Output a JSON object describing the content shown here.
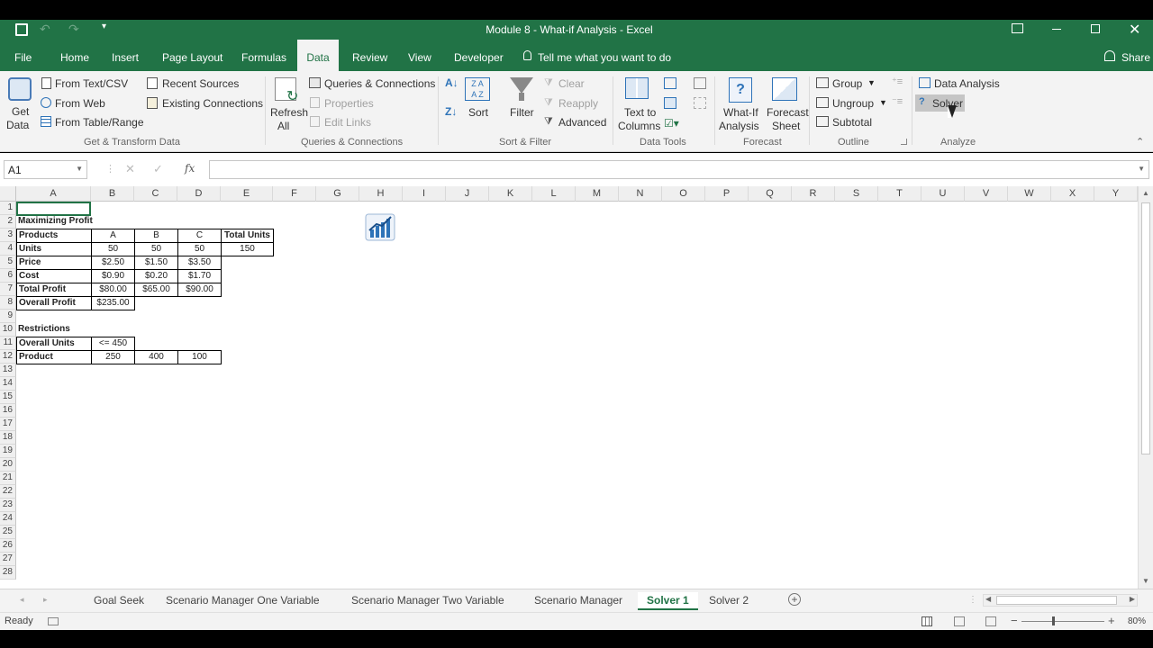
{
  "window": {
    "title": "Module 8 - What-if Analysis - Excel"
  },
  "ribbon_tabs": [
    "File",
    "Home",
    "Insert",
    "Page Layout",
    "Formulas",
    "Data",
    "Review",
    "View",
    "Developer"
  ],
  "tell_me": "Tell me what you want to do",
  "share_label": "Share",
  "ribbon": {
    "get_data": {
      "line1": "Get",
      "line2": "Data"
    },
    "from_text": "From Text/CSV",
    "from_web": "From Web",
    "from_table": "From Table/Range",
    "recent_sources": "Recent Sources",
    "existing_connections": "Existing Connections",
    "group_get_transform": "Get & Transform Data",
    "refresh": {
      "line1": "Refresh",
      "line2": "All"
    },
    "queries_connections": "Queries & Connections",
    "properties": "Properties",
    "edit_links": "Edit Links",
    "group_queries": "Queries & Connections",
    "sort": "Sort",
    "filter": "Filter",
    "clear": "Clear",
    "reapply": "Reapply",
    "advanced": "Advanced",
    "group_sort_filter": "Sort & Filter",
    "text_to_columns": {
      "line1": "Text to",
      "line2": "Columns"
    },
    "group_data_tools": "Data Tools",
    "what_if": {
      "line1": "What-If",
      "line2": "Analysis"
    },
    "forecast_sheet": {
      "line1": "Forecast",
      "line2": "Sheet"
    },
    "group_forecast": "Forecast",
    "group_btn": "Group",
    "ungroup": "Ungroup",
    "subtotal": "Subtotal",
    "group_outline": "Outline",
    "data_analysis": "Data Analysis",
    "solver": "Solver",
    "group_analyze": "Analyze"
  },
  "formula_bar": {
    "name_box": "A1",
    "formula": ""
  },
  "columns": [
    "A",
    "B",
    "C",
    "D",
    "E",
    "F",
    "G",
    "H",
    "I",
    "J",
    "K",
    "L",
    "M",
    "N",
    "O",
    "P",
    "Q",
    "R",
    "S",
    "T",
    "U",
    "V",
    "W",
    "X",
    "Y"
  ],
  "rows": [
    "1",
    "2",
    "3",
    "4",
    "5",
    "6",
    "7",
    "8",
    "9",
    "10",
    "11",
    "12",
    "13",
    "14",
    "15",
    "16",
    "17",
    "18",
    "19",
    "20",
    "21",
    "22",
    "23",
    "24",
    "25",
    "26",
    "27",
    "28"
  ],
  "cells": {
    "A2": "Maximizing Profit",
    "A3": "Products",
    "B3": "A",
    "C3": "B",
    "D3": "C",
    "E3": "Total Units",
    "A4": "Units",
    "B4": "50",
    "C4": "50",
    "D4": "50",
    "E4": "150",
    "A5": "Price",
    "B5": "$2.50",
    "C5": "$1.50",
    "D5": "$3.50",
    "A6": "Cost",
    "B6": "$0.90",
    "C6": "$0.20",
    "D6": "$1.70",
    "A7": "Total Profit",
    "B7": "$80.00",
    "C7": "$65.00",
    "D7": "$90.00",
    "A8": "Overall Profit",
    "B8": "$235.00",
    "A10": "Restrictions",
    "A11": "Overall Units",
    "B11": "<= 450",
    "A12": "Product",
    "B12": "250",
    "C12": "400",
    "D12": "100"
  },
  "sheet_tabs": [
    "Goal Seek",
    "Scenario Manager One Variable",
    "Scenario Manager Two Variable",
    "Scenario Manager",
    "Solver 1",
    "Solver 2"
  ],
  "active_sheet": "Solver 1",
  "status": {
    "ready": "Ready",
    "zoom": "80%"
  },
  "colors": {
    "excel_green": "#217346"
  }
}
